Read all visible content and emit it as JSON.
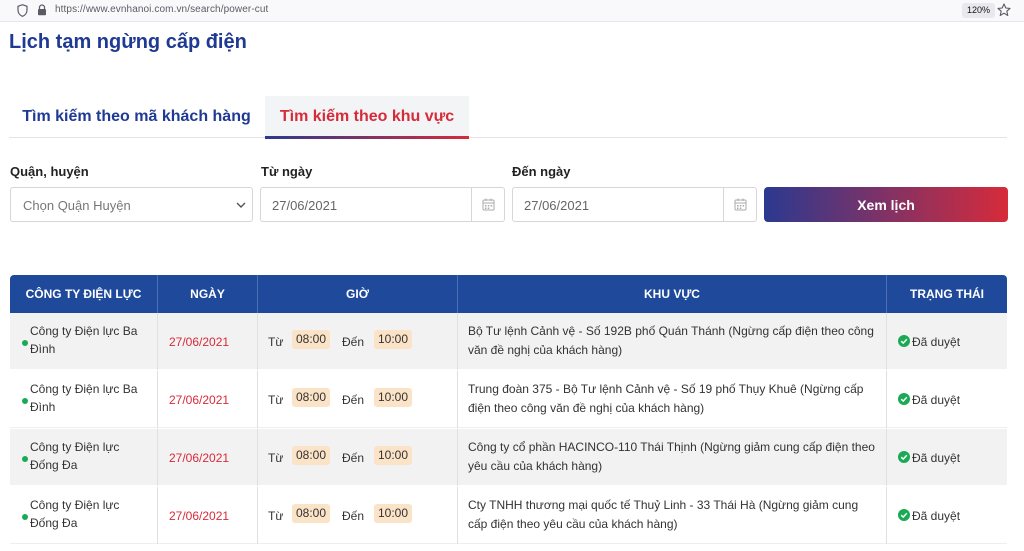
{
  "browser": {
    "url": "https://www.evnhanoi.com.vn/search/power-cut",
    "zoom": "120%"
  },
  "page": {
    "title": "Lịch tạm ngừng cấp điện"
  },
  "tabs": [
    {
      "label": "Tìm kiếm theo mã khách hàng",
      "active": false
    },
    {
      "label": "Tìm kiếm theo khu vực",
      "active": true
    }
  ],
  "filters": {
    "district_label": "Quận, huyện",
    "district_value": "Chọn Quận Huyện",
    "from_label": "Từ ngày",
    "from_value": "27/06/2021",
    "to_label": "Đến ngày",
    "to_value": "27/06/2021",
    "submit_label": "Xem lịch"
  },
  "colors": {
    "primary": "#1f4a9c",
    "accent": "#d62b3a",
    "status_ok": "#1aaa55"
  },
  "table": {
    "headers": [
      "CÔNG TY ĐIỆN LỰC",
      "NGÀY",
      "GIỜ",
      "KHU VỰC",
      "TRẠNG THÁI"
    ],
    "time_from_label": "Từ",
    "time_to_label": "Đến",
    "rows": [
      {
        "company": "Công ty Điện lực Ba Đình",
        "date": "27/06/2021",
        "from": "08:00",
        "to": "10:00",
        "area": "Bộ Tư lệnh Cảnh vệ - Số 192B phố Quán Thánh (Ngừng cấp điện theo công văn đề nghị của khách hàng)",
        "status": "Đã duyệt"
      },
      {
        "company": "Công ty Điện lực Ba Đình",
        "date": "27/06/2021",
        "from": "08:00",
        "to": "10:00",
        "area": "Trung đoàn 375 - Bộ Tư lệnh Cảnh vệ - Số 19 phố Thụy Khuê (Ngừng cấp điện theo công văn đề nghị của khách hàng)",
        "status": "Đã duyệt"
      },
      {
        "company": "Công ty Điện lực Đống Đa",
        "date": "27/06/2021",
        "from": "08:00",
        "to": "10:00",
        "area": "Công ty cổ phần HACINCO-110 Thái Thịnh (Ngừng giảm cung cấp điện theo yêu cầu của khách hàng)",
        "status": "Đã duyệt"
      },
      {
        "company": "Công ty Điện lực Đống Đa",
        "date": "27/06/2021",
        "from": "08:00",
        "to": "10:00",
        "area": "Cty TNHH thương mại quốc tế Thuỷ Linh - 33 Thái Hà (Ngừng giảm cung cấp điện theo yêu cầu của khách hàng)",
        "status": "Đã duyệt"
      }
    ]
  }
}
